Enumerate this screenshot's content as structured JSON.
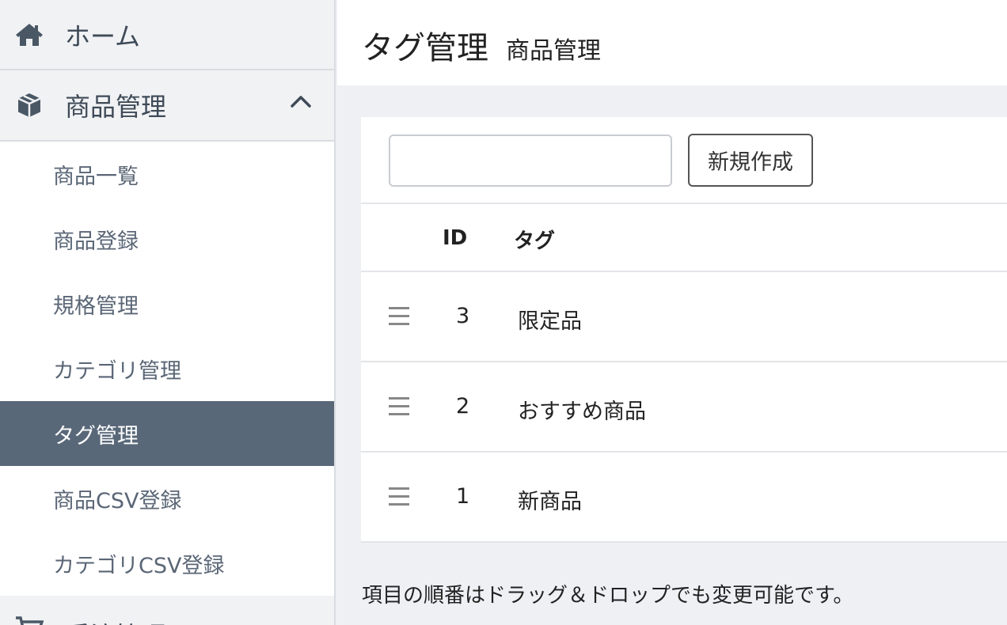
{
  "sidebar": {
    "home_label": "ホーム",
    "product_section_label": "商品管理",
    "sub_items": [
      {
        "label": "商品一覧"
      },
      {
        "label": "商品登録"
      },
      {
        "label": "規格管理"
      },
      {
        "label": "カテゴリ管理"
      },
      {
        "label": "タグ管理"
      },
      {
        "label": "商品CSV登録"
      },
      {
        "label": "カテゴリCSV登録"
      }
    ],
    "next_section_label": "受注管理",
    "active_index": 4
  },
  "header": {
    "title": "タグ管理",
    "subtitle": "商品管理"
  },
  "toolbar": {
    "search_value": "",
    "new_button_label": "新規作成"
  },
  "table": {
    "columns": [
      "ID",
      "タグ"
    ],
    "rows": [
      {
        "id": "3",
        "tag": "限定品"
      },
      {
        "id": "2",
        "tag": "おすすめ商品"
      },
      {
        "id": "1",
        "tag": "新商品"
      }
    ]
  },
  "footnote": "項目の順番はドラッグ＆ドロップでも変更可能です。",
  "colors": {
    "active_bg": "#596879",
    "sidebar_bg": "#f1f2f4",
    "page_bg": "#eef0f4"
  }
}
